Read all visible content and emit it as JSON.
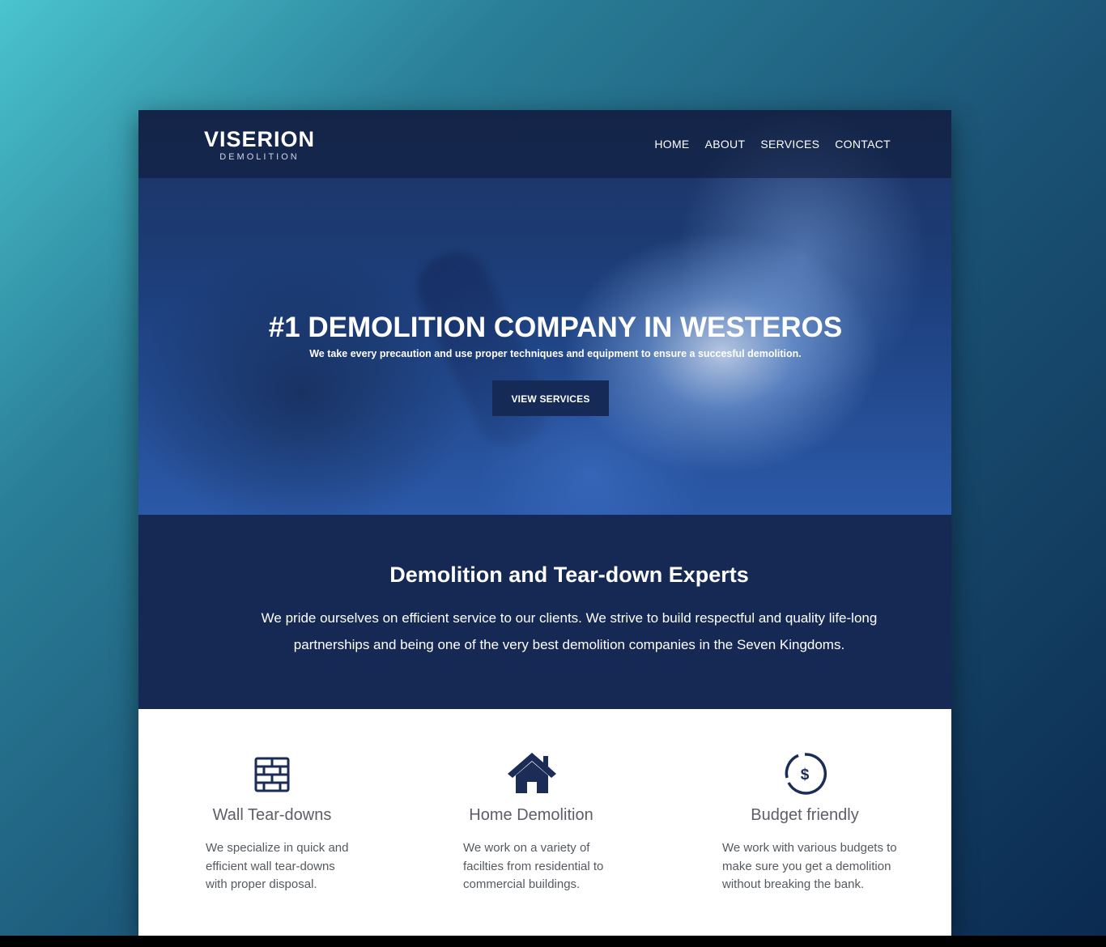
{
  "brand": {
    "name": "VISERION",
    "tagline": "DEMOLITION"
  },
  "nav": {
    "items": [
      {
        "label": "HOME"
      },
      {
        "label": "ABOUT"
      },
      {
        "label": "SERVICES"
      },
      {
        "label": "CONTACT"
      }
    ]
  },
  "hero": {
    "title": "#1 DEMOLITION COMPANY IN WESTEROS",
    "subtitle": "We take every precaution and use proper techniques and equipment to ensure a succesful demolition.",
    "button_label": "VIEW SERVICES"
  },
  "about": {
    "title": "Demolition and Tear-down Experts",
    "text": "We pride ourselves on efficient service to our clients. We strive to build respectful and quality life-long partnerships and being one of the very best demolition companies in the Seven Kingdoms."
  },
  "services": [
    {
      "icon": "brick-wall-icon",
      "title": "Wall Tear-downs",
      "text": "We specialize in quick and efficient wall tear-downs with proper disposal."
    },
    {
      "icon": "house-icon",
      "title": "Home Demolition",
      "text": "We work on a variety of facilties from residential to commercial buildings."
    },
    {
      "icon": "dollar-circle-icon",
      "title": "Budget friendly",
      "text": "We work with various budgets to make sure you get a demolition without breaking the bank."
    }
  ],
  "colors": {
    "navy": "#162954",
    "button": "#152a56",
    "icon": "#1b2c57",
    "muted_text": "#555a60"
  }
}
